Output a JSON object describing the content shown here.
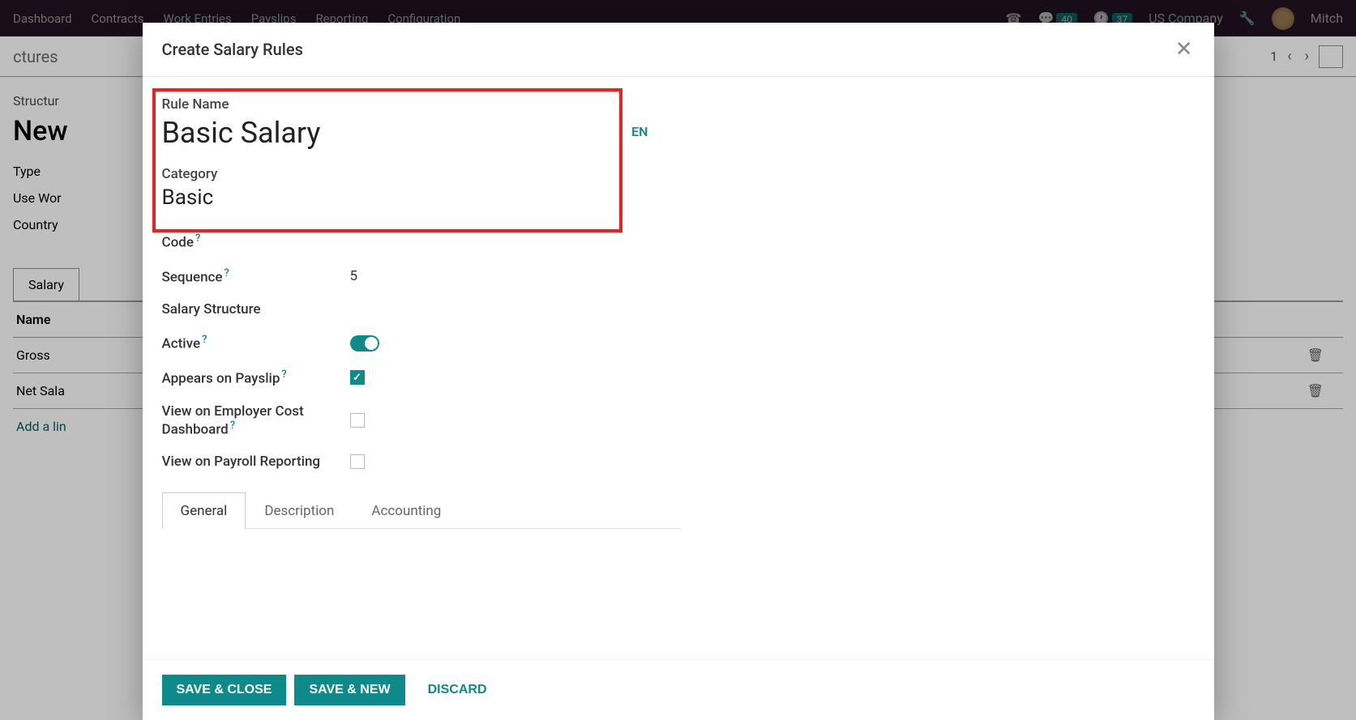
{
  "topbar": {
    "menu": [
      "Dashboard",
      "Contracts",
      "Work Entries",
      "Payslips",
      "Reporting",
      "Configuration"
    ],
    "messages_count": "40",
    "activities_count": "37",
    "company": "US Company",
    "user": "Mitch"
  },
  "background": {
    "breadcrumb": "ctures",
    "pager": "1",
    "structure_label": "Structur",
    "title": "New",
    "field_type": "Type",
    "field_use_work": "Use Wor",
    "field_country": "Country",
    "tab_salary": "Salary",
    "col_name": "Name",
    "rows": [
      "Gross",
      "Net Sala"
    ],
    "add_line": "Add a lin"
  },
  "modal": {
    "title": "Create Salary Rules",
    "rule_name_label": "Rule Name",
    "rule_name_value": "Basic Salary",
    "lang": "EN",
    "category_label": "Category",
    "category_value": "Basic",
    "fields": {
      "code_label": "Code",
      "sequence_label": "Sequence",
      "sequence_value": "5",
      "salary_structure_label": "Salary Structure",
      "active_label": "Active",
      "appears_label": "Appears on Payslip",
      "employer_cost_label": "View on Employer Cost Dashboard",
      "payroll_reporting_label": "View on Payroll Reporting"
    },
    "tabs": [
      "General",
      "Description",
      "Accounting"
    ],
    "footer": {
      "save_close": "SAVE & CLOSE",
      "save_new": "SAVE & NEW",
      "discard": "DISCARD"
    }
  }
}
